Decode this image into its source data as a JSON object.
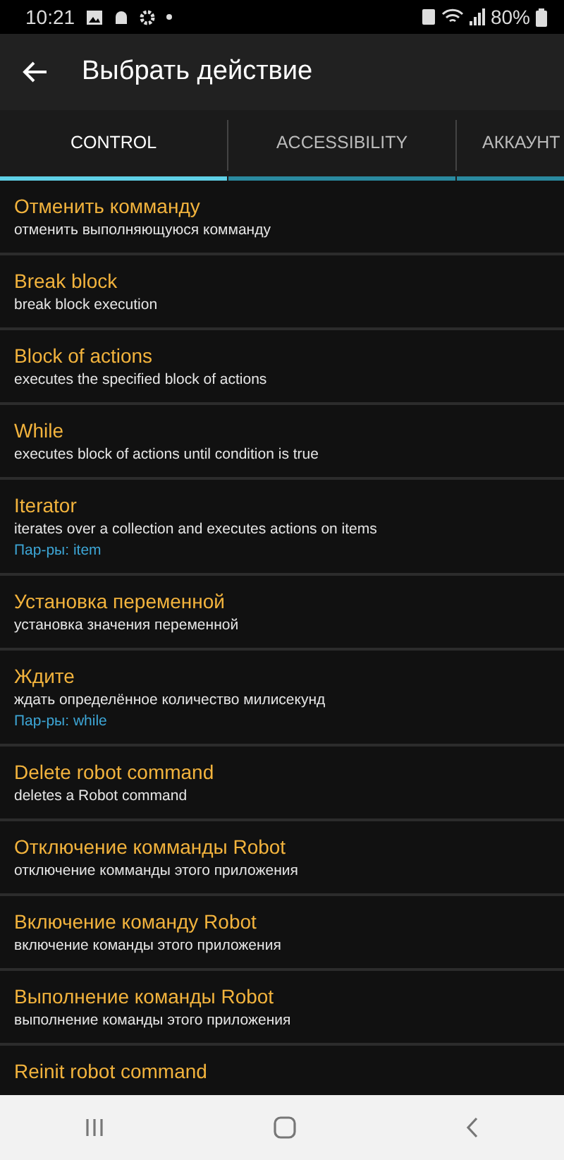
{
  "status_bar": {
    "time": "10:21",
    "battery": "80%"
  },
  "toolbar": {
    "title": "Выбрать действие"
  },
  "tabs": [
    {
      "label": "CONTROL",
      "selected": true
    },
    {
      "label": "ACCESSIBILITY",
      "selected": false
    },
    {
      "label": "АККАУНТ",
      "selected": false
    }
  ],
  "actions": [
    {
      "title": "Отменить комманду",
      "description": "отменить выполняющуюся комманду"
    },
    {
      "title": "Break block",
      "description": "break block execution"
    },
    {
      "title": "Block of actions",
      "description": "executes the specified block of actions"
    },
    {
      "title": "While",
      "description": "executes block of actions until condition is true"
    },
    {
      "title": "Iterator",
      "description": "iterates over a collection and executes actions on items",
      "params": "Пар-ры: item"
    },
    {
      "title": "Установка переменной",
      "description": "установка значения переменной"
    },
    {
      "title": "Ждите",
      "description": "ждать определённое количество милисекунд",
      "params": "Пар-ры: while"
    },
    {
      "title": "Delete robot command",
      "description": "deletes a Robot command"
    },
    {
      "title": "Отключение комманды Robot",
      "description": "отключение комманды этого приложения"
    },
    {
      "title": "Включение команду Robot",
      "description": "включение команды этого приложения"
    },
    {
      "title": "Выполнение команды Robot",
      "description": "выполнение команды этого приложения"
    },
    {
      "title": "Reinit robot command"
    }
  ]
}
